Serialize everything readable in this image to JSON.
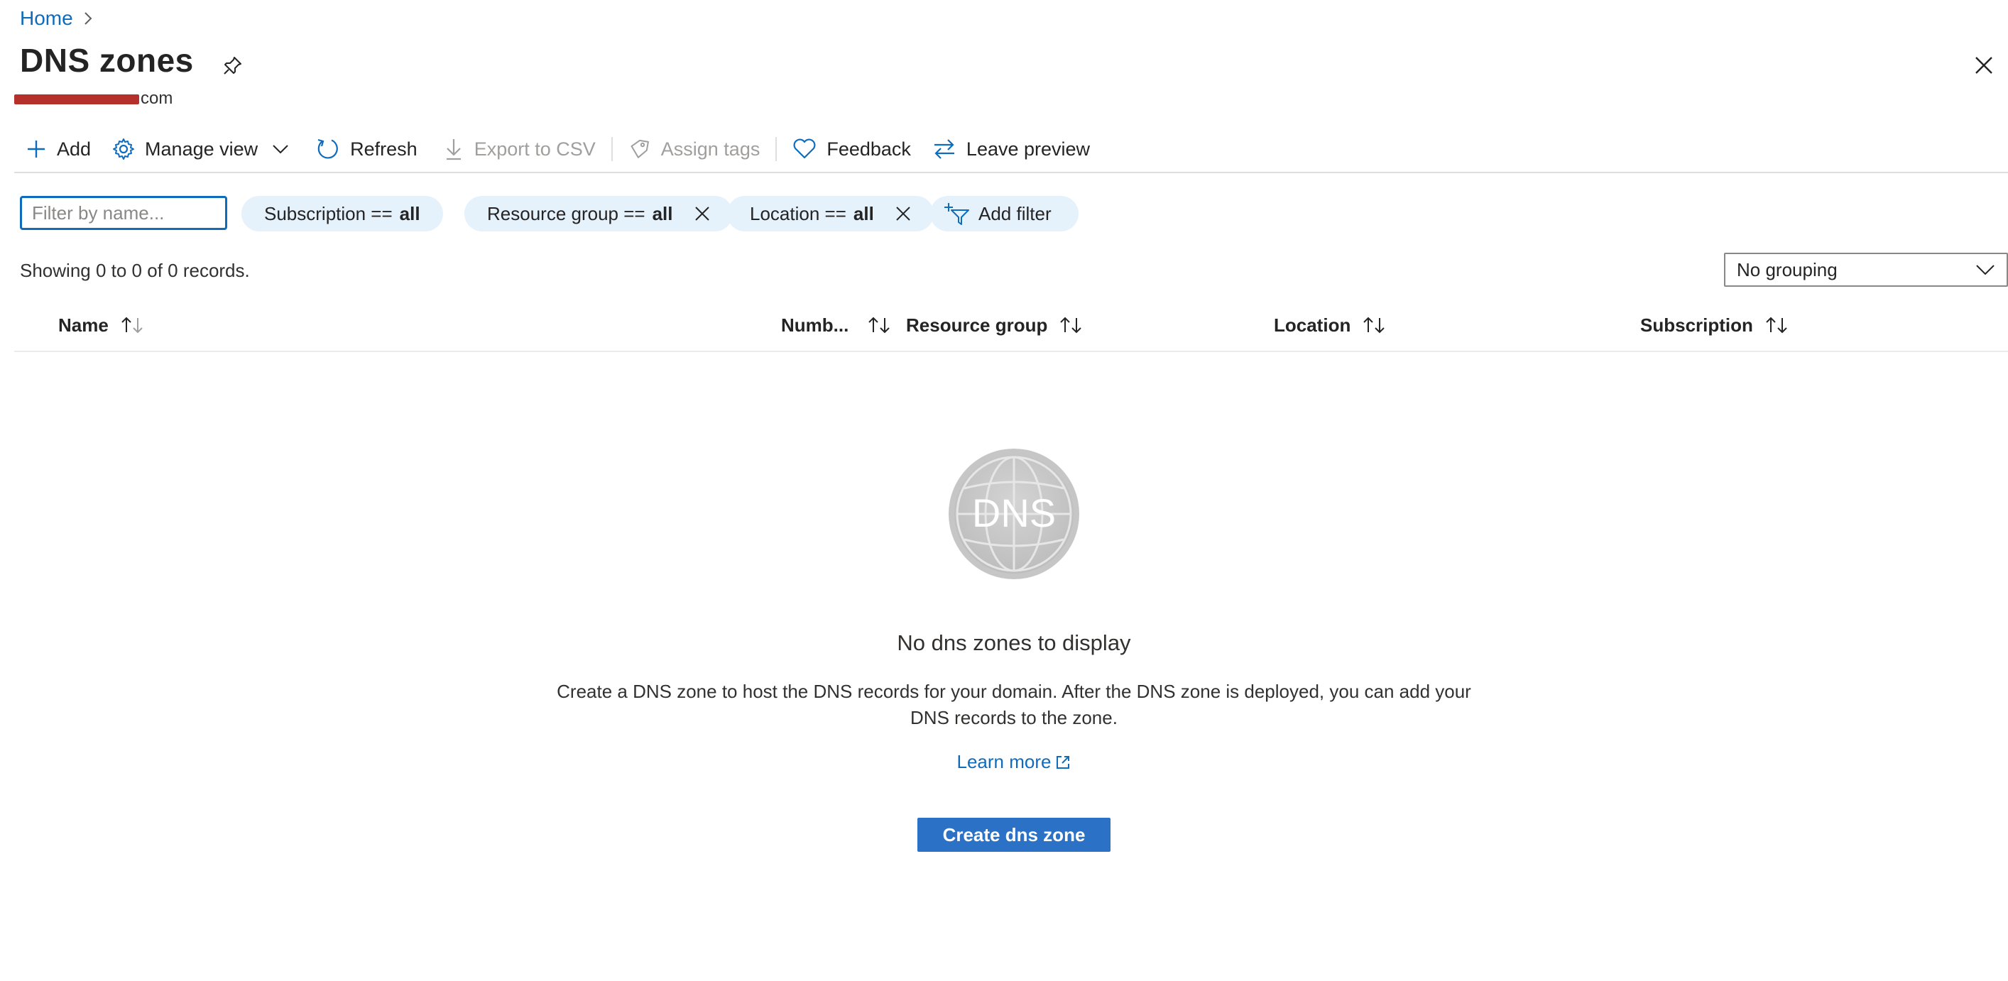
{
  "breadcrumb": {
    "home": "Home"
  },
  "header": {
    "title": "DNS zones",
    "subtitle_suffix": "com"
  },
  "toolbar": {
    "add": "Add",
    "manage_view": "Manage view",
    "refresh": "Refresh",
    "export_csv": "Export to CSV",
    "assign_tags": "Assign tags",
    "feedback": "Feedback",
    "leave_preview": "Leave preview"
  },
  "filters": {
    "search_placeholder": "Filter by name...",
    "subscription": {
      "label": "Subscription ==",
      "value": "all"
    },
    "resource_group": {
      "label": "Resource group ==",
      "value": "all"
    },
    "location": {
      "label": "Location ==",
      "value": "all"
    },
    "add_filter": "Add filter"
  },
  "records": {
    "summary": "Showing 0 to 0 of 0 records.",
    "grouping": "No grouping"
  },
  "table": {
    "columns": [
      "Name",
      "Numb...",
      "Resource group",
      "Location",
      "Subscription"
    ]
  },
  "empty_state": {
    "logo_text": "DNS",
    "title": "No dns zones to display",
    "description": "Create a DNS zone to host the DNS records for your domain. After the DNS zone is deployed, you can add your DNS records to the zone.",
    "learn_more": "Learn more",
    "create_button": "Create dns zone"
  },
  "colors": {
    "accent": "#0f6cbd",
    "primary_button": "#2b72c6",
    "pill_bg": "#e5f1fb",
    "redaction": "#b5302a"
  }
}
